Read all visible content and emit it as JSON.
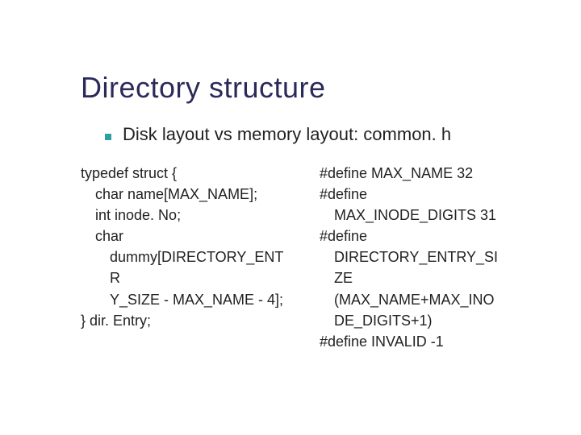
{
  "title": "Directory structure",
  "subtitle": "Disk layout vs memory layout: common. h",
  "left": {
    "l1": "typedef struct {",
    "l2": "char name[MAX_NAME];",
    "l3": "int inode. No;",
    "l4": "char",
    "l5": "dummy[DIRECTORY_ENTR",
    "l6": "Y_SIZE - MAX_NAME - 4];",
    "l7": "} dir. Entry;"
  },
  "right": {
    "r1": "#define MAX_NAME 32",
    "r2": "#define",
    "r3": "MAX_INODE_DIGITS 31",
    "r4": "#define",
    "r5": "DIRECTORY_ENTRY_SI",
    "r6": "ZE",
    "r7": "(MAX_NAME+MAX_INO",
    "r8": "DE_DIGITS+1)",
    "r9": "#define INVALID -1"
  }
}
